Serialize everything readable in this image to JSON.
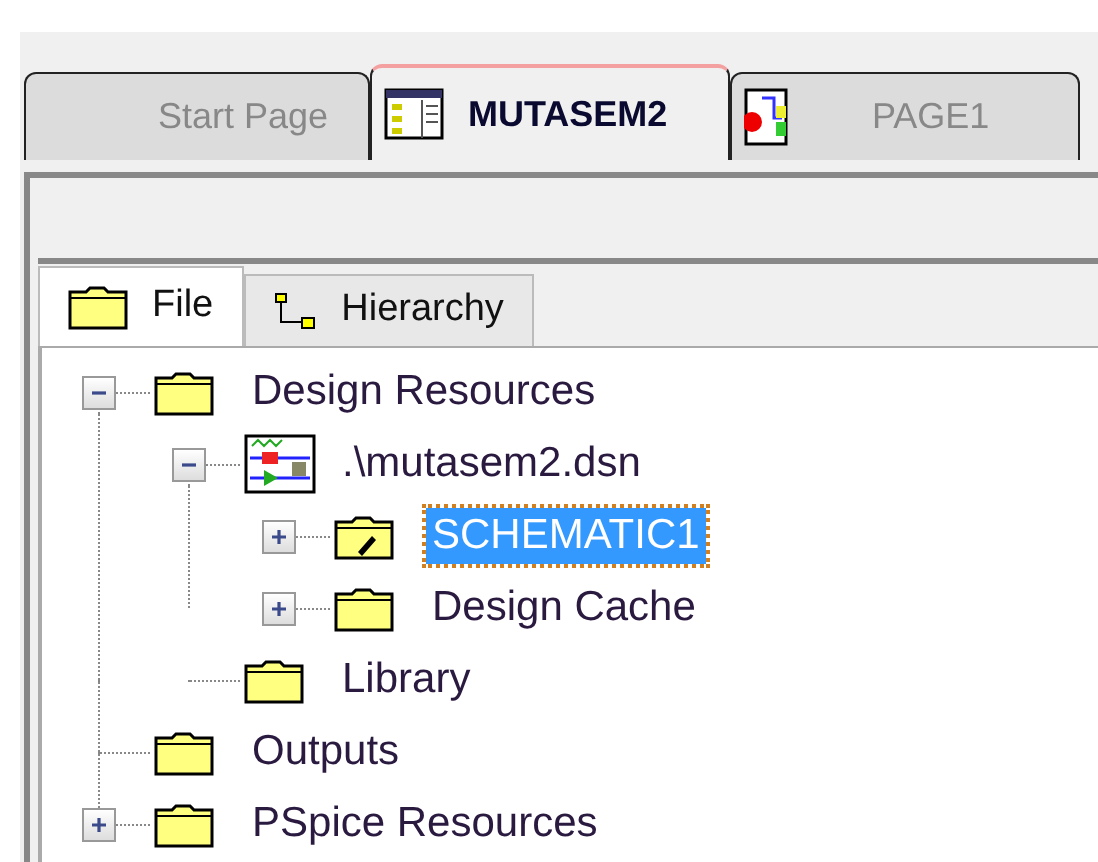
{
  "doc_tabs": [
    {
      "label": "Start Page",
      "kind": "plain",
      "selected": false
    },
    {
      "label": "MUTASEM2",
      "kind": "design",
      "selected": true
    },
    {
      "label": "PAGE1",
      "kind": "page",
      "selected": false
    }
  ],
  "panel_tabs": [
    {
      "label": "File",
      "kind": "files",
      "selected": true
    },
    {
      "label": "Hierarchy",
      "kind": "hierarchy",
      "selected": false
    }
  ],
  "tree": [
    {
      "label": "Design Resources",
      "kind": "folder",
      "expanded": true,
      "selected": false,
      "children": [
        {
          "label": ".\\mutasem2.dsn",
          "kind": "design-file",
          "expanded": true,
          "selected": false,
          "children": [
            {
              "label": "SCHEMATIC1",
              "kind": "schematic-folder",
              "expanded": false,
              "selected": true
            },
            {
              "label": "Design Cache",
              "kind": "folder",
              "expanded": false,
              "selected": false
            }
          ]
        },
        {
          "label": "Library",
          "kind": "folder",
          "selected": false
        }
      ]
    },
    {
      "label": "Outputs",
      "kind": "folder",
      "selected": false
    },
    {
      "label": "PSpice Resources",
      "kind": "folder",
      "expanded": false,
      "selected": false
    }
  ]
}
